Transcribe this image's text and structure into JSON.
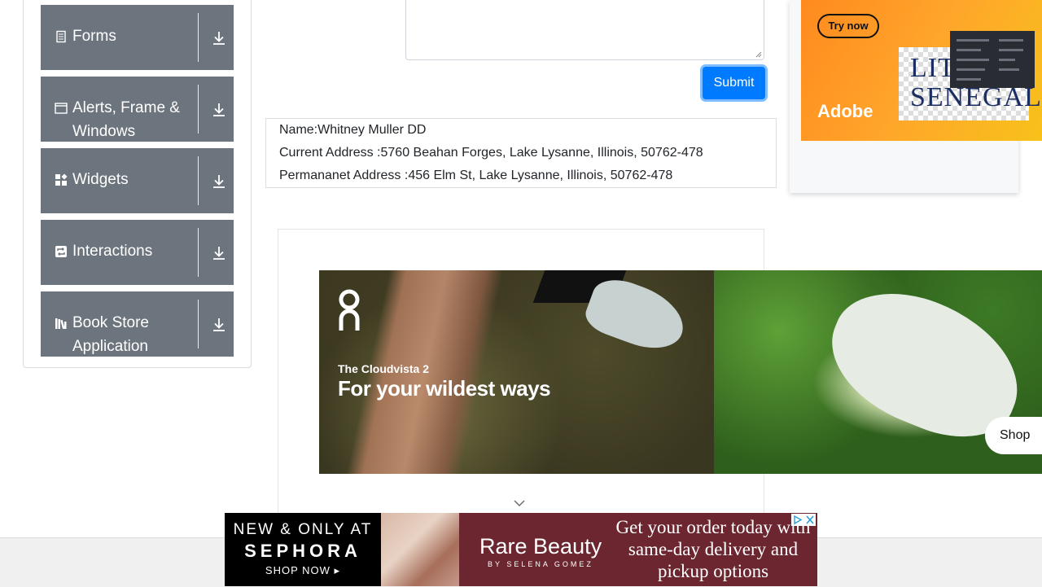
{
  "sidebar": {
    "groups": [
      {
        "label": "Forms",
        "icon": "form-icon"
      },
      {
        "label": "Alerts, Frame & Windows",
        "icon": "window-icon"
      },
      {
        "label": "Widgets",
        "icon": "widgets-icon"
      },
      {
        "label": "Interactions",
        "icon": "interactions-icon"
      },
      {
        "label": "Book Store Application",
        "icon": "books-icon"
      }
    ]
  },
  "form": {
    "submit_label": "Submit"
  },
  "output": {
    "name": "Name:Whitney Muller DD",
    "current_address": "Current Address :5760 Beahan Forges, Lake Lysanne, Illinois, 50762-478",
    "permanent_address": "Permananet Address :456 Elm St, Lake Lysanne, Illinois, 50762-478"
  },
  "ads": {
    "adobe": {
      "try_now": "Try now",
      "brand": "Adobe",
      "art_text": "LITT SENEGAL"
    },
    "on": {
      "subtitle": "The Cloudvista 2",
      "title": "For your wildest ways",
      "cta": "Shop"
    },
    "sephora": {
      "line1": "NEW & ONLY AT",
      "line2": "SEPHORA",
      "line3": "SHOP NOW ▸",
      "brand": "Rare Beauty",
      "brand_sub": "BY SELENA GOMEZ",
      "message": "Get your order today with same-day delivery and pickup options"
    }
  },
  "colors": {
    "sidebar_group_bg": "#6c757d",
    "submit_bg": "#007bff"
  }
}
